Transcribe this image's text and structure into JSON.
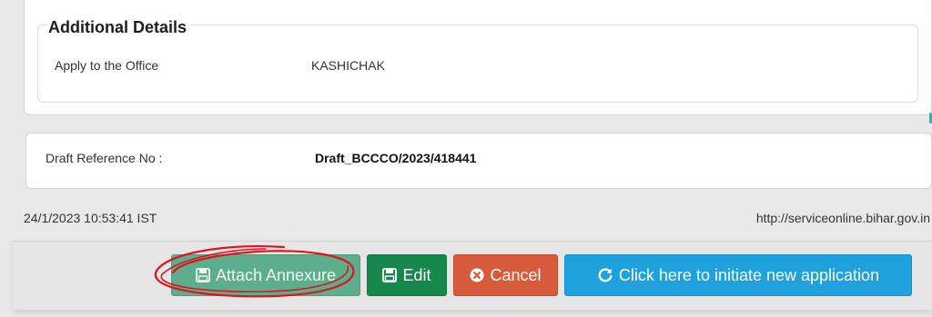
{
  "additional_details": {
    "title": "Additional Details",
    "office_label": "Apply to the Office",
    "office_value": "KASHICHAK"
  },
  "draft": {
    "label": "Draft Reference No :",
    "value": "Draft_BCCCO/2023/418441"
  },
  "footer": {
    "timestamp": "24/1/2023 10:53:41 IST",
    "url": "http://serviceonline.bihar.gov.in"
  },
  "actions": {
    "attach_label": "Attach Annexure",
    "edit_label": "Edit",
    "cancel_label": "Cancel",
    "new_application_label": "Click here to initiate new application"
  },
  "icons": {
    "attach": "save-icon",
    "edit": "save-icon",
    "cancel": "close-circle-icon",
    "new_application": "refresh-icon"
  },
  "colors": {
    "attach_button": "#5cae8d",
    "edit_button": "#16884b",
    "cancel_button": "#d75a3b",
    "new_application_button": "#1ea1dc",
    "annotation": "#e0141f"
  }
}
